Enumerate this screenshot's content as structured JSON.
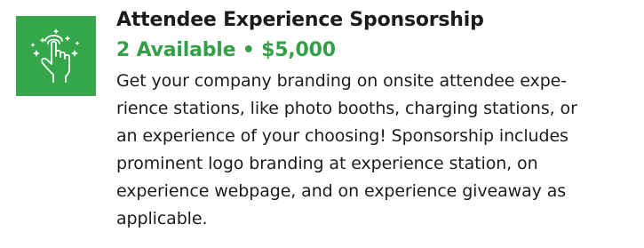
{
  "sponsorship": {
    "icon": "hand-tap-sparkle-icon",
    "accent_color": "#35a64a",
    "title": "Attendee Experience Sponsorship",
    "availability": "2 Available • $5,000",
    "description_lines": [
      "Get your company branding on onsite attendee expe-",
      "rience stations, like photo booths, charging stations, or",
      "an experience of your choosing! Sponsorship includes",
      "prominent logo branding at experience station, on",
      "experience webpage, and on experience giveaway as",
      "applicable."
    ]
  }
}
